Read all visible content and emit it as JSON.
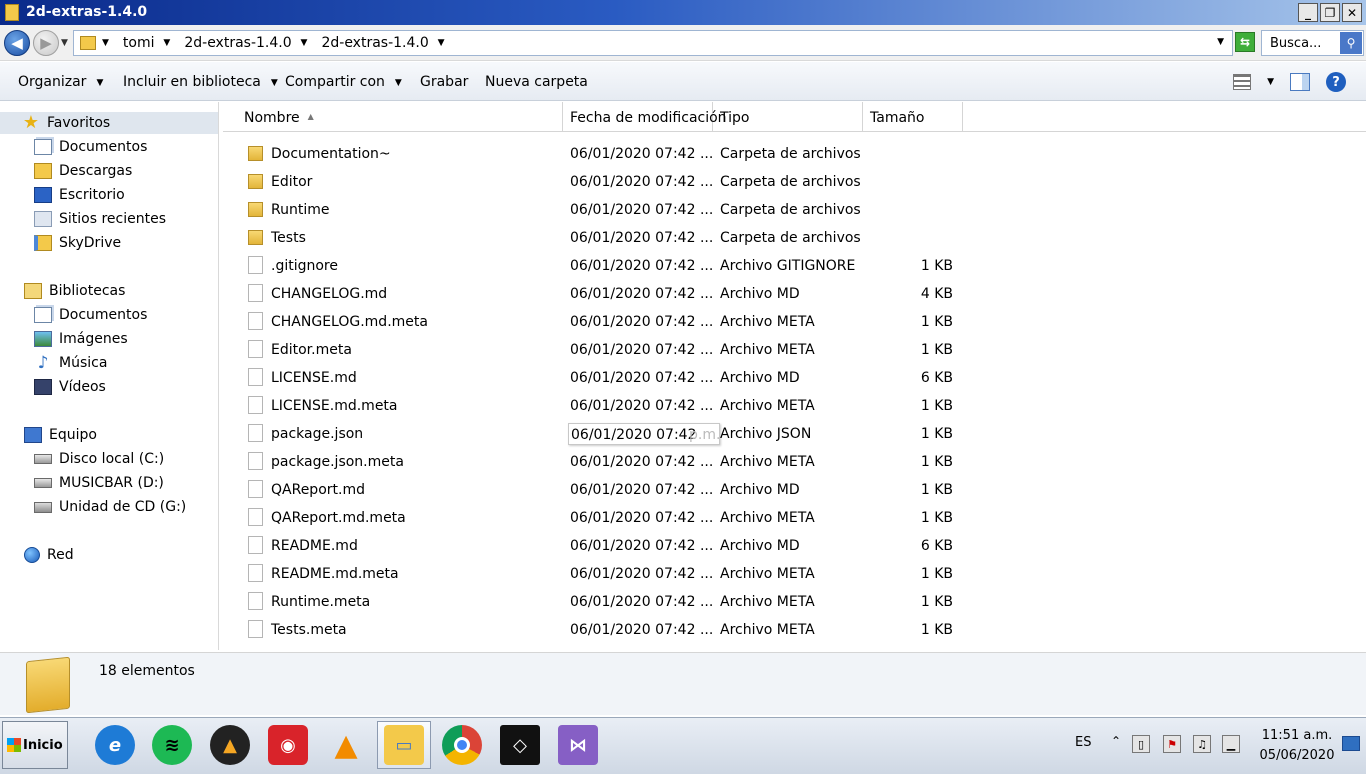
{
  "window": {
    "title": "2d-extras-1.4.0",
    "btn_min": "_",
    "btn_max": "❐",
    "btn_close": "✕"
  },
  "address": {
    "crumbs": [
      "tomi",
      "2d-extras-1.4.0",
      "2d-extras-1.4.0"
    ],
    "search_placeholder": "Busca..."
  },
  "toolbar": {
    "organize": "Organizar",
    "include": "Incluir en biblioteca",
    "share": "Compartir con",
    "burn": "Grabar",
    "new_folder": "Nueva carpeta",
    "help": "?"
  },
  "nav": {
    "favorites": "Favoritos",
    "fav_items": [
      "Documentos",
      "Descargas",
      "Escritorio",
      "Sitios recientes",
      "SkyDrive"
    ],
    "libraries": "Bibliotecas",
    "lib_items": [
      "Documentos",
      "Imágenes",
      "Música",
      "Vídeos"
    ],
    "computer": "Equipo",
    "comp_items": [
      "Disco local (C:)",
      "MUSICBAR (D:)",
      "Unidad de CD (G:)"
    ],
    "network": "Red"
  },
  "columns": {
    "name": "Nombre",
    "date": "Fecha de modificación",
    "type": "Tipo",
    "size": "Tamaño"
  },
  "files": [
    {
      "name": "Documentation~",
      "date": "06/01/2020 07:42 ...",
      "type": "Carpeta de archivos",
      "size": "",
      "kind": "folder"
    },
    {
      "name": "Editor",
      "date": "06/01/2020 07:42 ...",
      "type": "Carpeta de archivos",
      "size": "",
      "kind": "folder"
    },
    {
      "name": "Runtime",
      "date": "06/01/2020 07:42 ...",
      "type": "Carpeta de archivos",
      "size": "",
      "kind": "folder"
    },
    {
      "name": "Tests",
      "date": "06/01/2020 07:42 ...",
      "type": "Carpeta de archivos",
      "size": "",
      "kind": "folder"
    },
    {
      "name": ".gitignore",
      "date": "06/01/2020 07:42 ...",
      "type": "Archivo GITIGNORE",
      "size": "1 KB",
      "kind": "file"
    },
    {
      "name": "CHANGELOG.md",
      "date": "06/01/2020 07:42 ...",
      "type": "Archivo MD",
      "size": "4 KB",
      "kind": "file"
    },
    {
      "name": "CHANGELOG.md.meta",
      "date": "06/01/2020 07:42 ...",
      "type": "Archivo META",
      "size": "1 KB",
      "kind": "file"
    },
    {
      "name": "Editor.meta",
      "date": "06/01/2020 07:42 ...",
      "type": "Archivo META",
      "size": "1 KB",
      "kind": "file"
    },
    {
      "name": "LICENSE.md",
      "date": "06/01/2020 07:42 ...",
      "type": "Archivo MD",
      "size": "6 KB",
      "kind": "file"
    },
    {
      "name": "LICENSE.md.meta",
      "date": "06/01/2020 07:42 ...",
      "type": "Archivo META",
      "size": "1 KB",
      "kind": "file"
    },
    {
      "name": "package.json",
      "date": "06/01/2020 07:42",
      "type": "Archivo JSON",
      "size": "1 KB",
      "kind": "file",
      "tooltip_tail": "p.m."
    },
    {
      "name": "package.json.meta",
      "date": "06/01/2020 07:42 ...",
      "type": "Archivo META",
      "size": "1 KB",
      "kind": "file"
    },
    {
      "name": "QAReport.md",
      "date": "06/01/2020 07:42 ...",
      "type": "Archivo MD",
      "size": "1 KB",
      "kind": "file"
    },
    {
      "name": "QAReport.md.meta",
      "date": "06/01/2020 07:42 ...",
      "type": "Archivo META",
      "size": "1 KB",
      "kind": "file"
    },
    {
      "name": "README.md",
      "date": "06/01/2020 07:42 ...",
      "type": "Archivo MD",
      "size": "6 KB",
      "kind": "file"
    },
    {
      "name": "README.md.meta",
      "date": "06/01/2020 07:42 ...",
      "type": "Archivo META",
      "size": "1 KB",
      "kind": "file"
    },
    {
      "name": "Runtime.meta",
      "date": "06/01/2020 07:42 ...",
      "type": "Archivo META",
      "size": "1 KB",
      "kind": "file"
    },
    {
      "name": "Tests.meta",
      "date": "06/01/2020 07:42 ...",
      "type": "Archivo META",
      "size": "1 KB",
      "kind": "file"
    }
  ],
  "status": {
    "count": "18 elementos"
  },
  "taskbar": {
    "start": "Inicio",
    "apps": [
      "internet-explorer-icon",
      "spotify-icon",
      "aimp-icon",
      "media-player-icon",
      "vlc-icon",
      "file-explorer-icon",
      "chrome-icon",
      "unity-icon",
      "visual-studio-icon"
    ],
    "lang": "ES",
    "time": "11:51 a.m.",
    "date": "05/06/2020"
  },
  "colors": {
    "accent": "#2a5bc2",
    "selection": "#dfe6ee",
    "folder": "#f3c94a"
  }
}
